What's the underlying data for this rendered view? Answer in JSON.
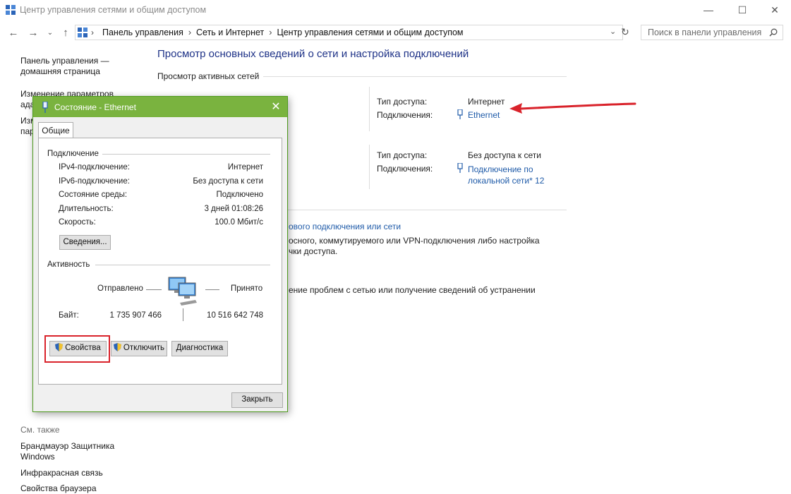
{
  "window": {
    "title": "Центр управления сетями и общим доступом",
    "minimize": "—",
    "maximize": "☐",
    "close": "✕"
  },
  "address": {
    "crumbs": [
      "Панель управления",
      "Сеть и Интернет",
      "Центр управления сетями и общим доступом"
    ],
    "search_placeholder": "Поиск в панели управления"
  },
  "sidebar": {
    "home": "Панель управления — домашняя страница",
    "items": [
      "Изменение параметров ада",
      "Изм пар"
    ],
    "see_also_title": "См. также",
    "see_also": [
      "Брандмауэр Защитника Windows",
      "Инфракрасная связь",
      "Свойства браузера"
    ]
  },
  "main": {
    "title": "Просмотр основных сведений о сети и настройка подключений",
    "active_networks": "Просмотр активных сетей",
    "networks": [
      {
        "access_label": "Тип доступа:",
        "access_value": "Интернет",
        "conn_label": "Подключения:",
        "conn_value": "Ethernet"
      },
      {
        "access_label": "Тип доступа:",
        "access_value": "Без доступа к сети",
        "conn_label": "Подключения:",
        "conn_value": "Подключение по локальной сети* 12"
      }
    ],
    "change_settings": [
      "ового подключения или сети",
      "осного, коммутируемого или VPN-подключения либо настройка",
      "чки доступа.",
      "ение проблем с сетью или получение сведений об устранении"
    ]
  },
  "dialog": {
    "title": "Состояние - Ethernet",
    "tab": "Общие",
    "connection_group": "Подключение",
    "rows": [
      {
        "label": "IPv4-подключение:",
        "value": "Интернет"
      },
      {
        "label": "IPv6-подключение:",
        "value": "Без доступа к сети"
      },
      {
        "label": "Состояние среды:",
        "value": "Подключено"
      },
      {
        "label": "Длительность:",
        "value": "3 дней 01:08:26"
      },
      {
        "label": "Скорость:",
        "value": "100.0 Мбит/с"
      }
    ],
    "details_button": "Сведения...",
    "activity_group": "Активность",
    "sent_label": "Отправлено",
    "received_label": "Принято",
    "bytes_label": "Байт:",
    "bytes_sent": "1 735 907 466",
    "bytes_received": "10 516 642 748",
    "properties_button": "Свойства",
    "disable_button": "Отключить",
    "diagnose_button": "Диагностика",
    "close_button": "Закрыть"
  },
  "colors": {
    "accent_title": "#7ab33f",
    "link": "#1e5aa8",
    "annotation": "#d9232b"
  }
}
